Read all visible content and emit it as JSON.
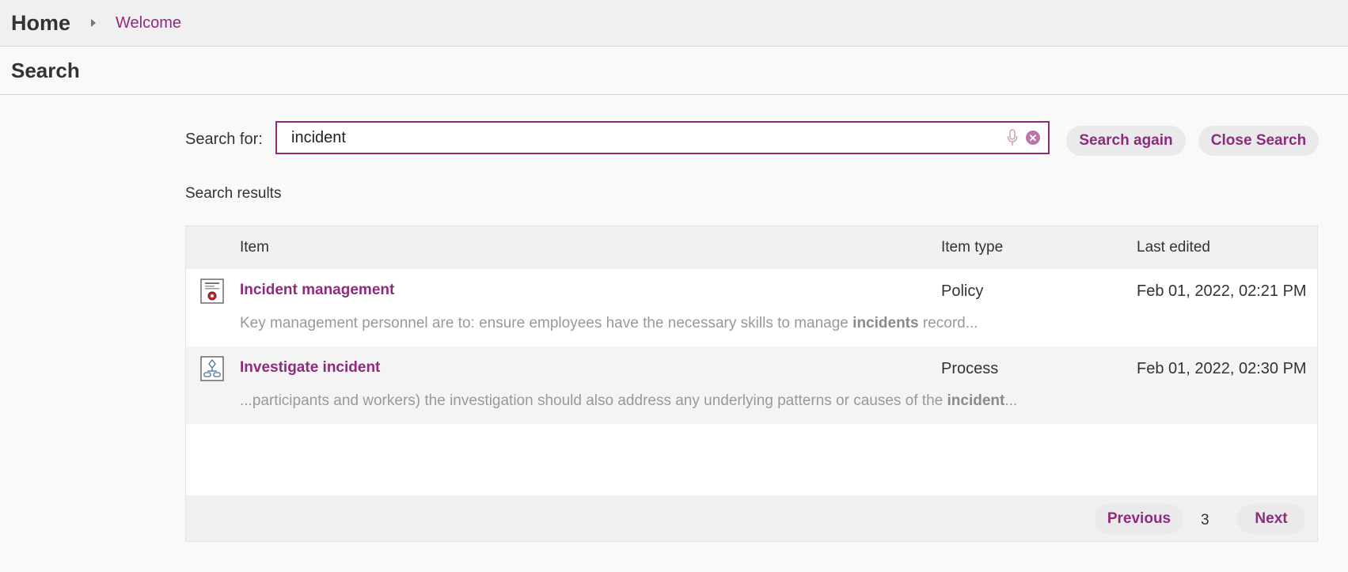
{
  "breadcrumb": {
    "home": "Home",
    "current": "Welcome"
  },
  "page": {
    "title": "Search"
  },
  "search": {
    "label": "Search for:",
    "value": "incident",
    "search_again_label": "Search again",
    "close_search_label": "Close Search"
  },
  "results": {
    "heading": "Search results",
    "columns": {
      "item": "Item",
      "type": "Item type",
      "date": "Last edited"
    },
    "rows": [
      {
        "icon": "policy-icon",
        "title": "Incident management",
        "type": "Policy",
        "date": "Feb 01, 2022, 02:21 PM",
        "snippet_before": "Key management personnel are to: ensure employees have the necessary skills to manage ",
        "snippet_highlight": "incidents",
        "snippet_after": " record..."
      },
      {
        "icon": "process-icon",
        "title": "Investigate incident",
        "type": "Process",
        "date": "Feb 01, 2022, 02:30 PM",
        "snippet_before": "...participants and workers) the investigation should also address any underlying patterns or causes of the ",
        "snippet_highlight": "incident",
        "snippet_after": "..."
      }
    ]
  },
  "pagination": {
    "previous_label": "Previous",
    "page": "3",
    "next_label": "Next"
  },
  "colors": {
    "accent": "#8e2b7d",
    "pill_bg": "#eaeaea",
    "header_bg": "#f0f0f0"
  }
}
